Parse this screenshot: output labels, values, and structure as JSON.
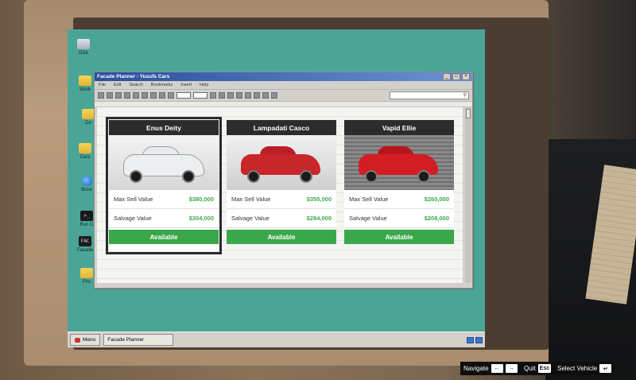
{
  "desktop": {
    "icons": [
      {
        "label": "Disk",
        "kind": "disk"
      },
      {
        "label": "Work",
        "kind": "folder"
      },
      {
        "label": "Do",
        "kind": "folder"
      },
      {
        "label": "Cars",
        "kind": "folder"
      },
      {
        "label": "Brow",
        "kind": "globe"
      },
      {
        "label": "Run C",
        "kind": "term",
        "glyph": ">_"
      },
      {
        "label": "Facade",
        "kind": "term",
        "glyph": "FAC"
      },
      {
        "label": "Pris",
        "kind": "folder"
      }
    ]
  },
  "window": {
    "title": "Facade Planner - Yusufs Cars",
    "buttons": {
      "minimize": "_",
      "maximize": "□",
      "close": "×"
    },
    "menu": [
      "File",
      "Edit",
      "Search",
      "Bookmarks",
      "Insert",
      "Help"
    ]
  },
  "cars": [
    {
      "name": "Enus Deity",
      "max_sell_label": "Max Sell Value",
      "max_sell": "$380,000",
      "salvage_label": "Salvage Value",
      "salvage": "$304,000",
      "status": "Available",
      "selected": true,
      "color": "#eceeef"
    },
    {
      "name": "Lampadati Casco",
      "max_sell_label": "Max Sell Value",
      "max_sell": "$355,000",
      "salvage_label": "Salvage Value",
      "salvage": "$284,000",
      "status": "Available",
      "selected": false,
      "color": "#c7262a"
    },
    {
      "name": "Vapid Ellie",
      "max_sell_label": "Max Sell Value",
      "max_sell": "$260,000",
      "salvage_label": "Salvage Value",
      "salvage": "$208,000",
      "status": "Available",
      "selected": false,
      "color": "#d21d23"
    }
  ],
  "taskbar": {
    "start_label": "Menu",
    "task_label": "Facade Planner"
  },
  "controls": [
    {
      "label": "Navigate",
      "keys": [
        "←",
        "→"
      ]
    },
    {
      "label": "Quit",
      "keys": [
        "Esc"
      ]
    },
    {
      "label": "Select Vehicle",
      "keys": [
        "↵"
      ]
    }
  ],
  "colors": {
    "desktop": "#4aa597",
    "available": "#3aa84a",
    "value_text": "#3fa94c",
    "title_bg": "#2c2c2c"
  }
}
